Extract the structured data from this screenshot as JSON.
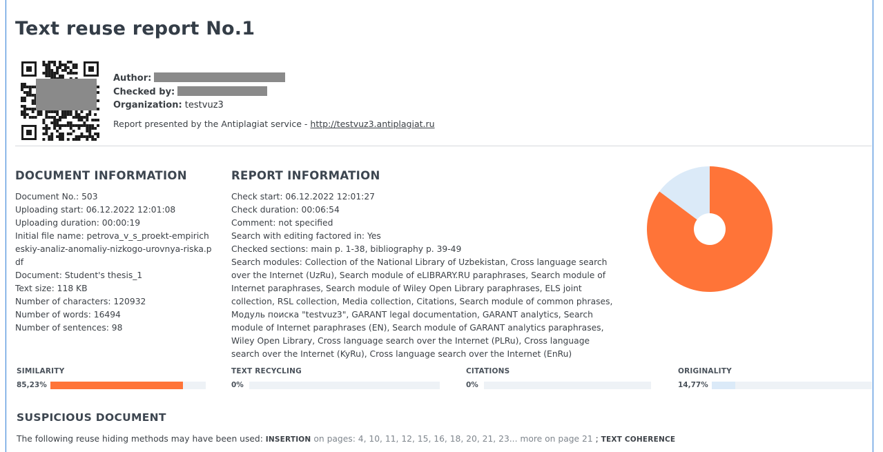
{
  "report": {
    "title": "Text reuse report No.1",
    "author_label": "Author:",
    "checked_by_label": "Checked by:",
    "organization_label": "Organization:",
    "organization_value": "testvuz3",
    "presented_text": "Report presented by the Antiplagiat service - ",
    "presented_link": "http://testvuz3.antiplagiat.ru"
  },
  "document_info": {
    "heading": "DOCUMENT INFORMATION",
    "lines": [
      "Document No.: 503",
      "Uploading start: 06.12.2022 12:01:08",
      "Uploading duration: 00:00:19",
      "Initial file name: petrova_v_s_proekt-empiricheskiy-analiz-anomaliy-nizkogo-urovnya-riska.pdf",
      "Document: Student's thesis_1",
      "Text size: 118 KB",
      "Number of characters: 120932",
      "Number of words: 16494",
      "Number of sentences: 98"
    ]
  },
  "report_info": {
    "heading": "REPORT INFORMATION",
    "lines": [
      "Check start: 06.12.2022 12:01:27",
      "Check duration: 00:06:54",
      "Comment: not specified",
      "Search with editing factored in: Yes",
      "Checked sections: main p. 1-38, bibliography p. 39-49",
      "Search modules: Collection of the National Library of Uzbekistan, Cross language search over the Internet (UzRu), Search module of eLIBRARY.RU paraphrases, Search module of Internet paraphrases, Search module of Wiley Open Library paraphrases, ELS joint collection, RSL collection, Media collection, Citations, Search module of common phrases, Модуль поиска \"testvuz3\", GARANT legal documentation, GARANT analytics, Search module of Internet paraphrases (EN), Search module of GARANT analytics paraphrases, Wiley Open Library, Cross language search over the Internet (PLRu), Cross language search over the Internet (KyRu), Cross language search over the Internet (EnRu)"
    ]
  },
  "stats": [
    {
      "label": "SIMILARITY",
      "value": "85,23%",
      "fraction": 0.8523,
      "color": "#ff7438"
    },
    {
      "label": "TEXT RECYCLING",
      "value": "0%",
      "fraction": 0,
      "color": "#ff7438"
    },
    {
      "label": "CITATIONS",
      "value": "0%",
      "fraction": 0,
      "color": "#ff7438"
    },
    {
      "label": "ORIGINALITY",
      "value": "14,77%",
      "fraction": 0.1477,
      "color": "#dbeaf8"
    }
  ],
  "pie": {
    "similarity_fraction": 0.8523,
    "originality_fraction": 0.1477,
    "similarity_color": "#ff7438",
    "originality_color": "#dbeaf8"
  },
  "suspicious": {
    "heading": "SUSPICIOUS DOCUMENT",
    "intro": "The following reuse hiding methods may have been used:",
    "method1": "INSERTION",
    "method1_pages": "on pages: 4, 10, 11, 12, 15, 16, 18, 20, 21, 23... more on page 21",
    "separator": ";",
    "method2": "TEXT COHERENCE"
  }
}
